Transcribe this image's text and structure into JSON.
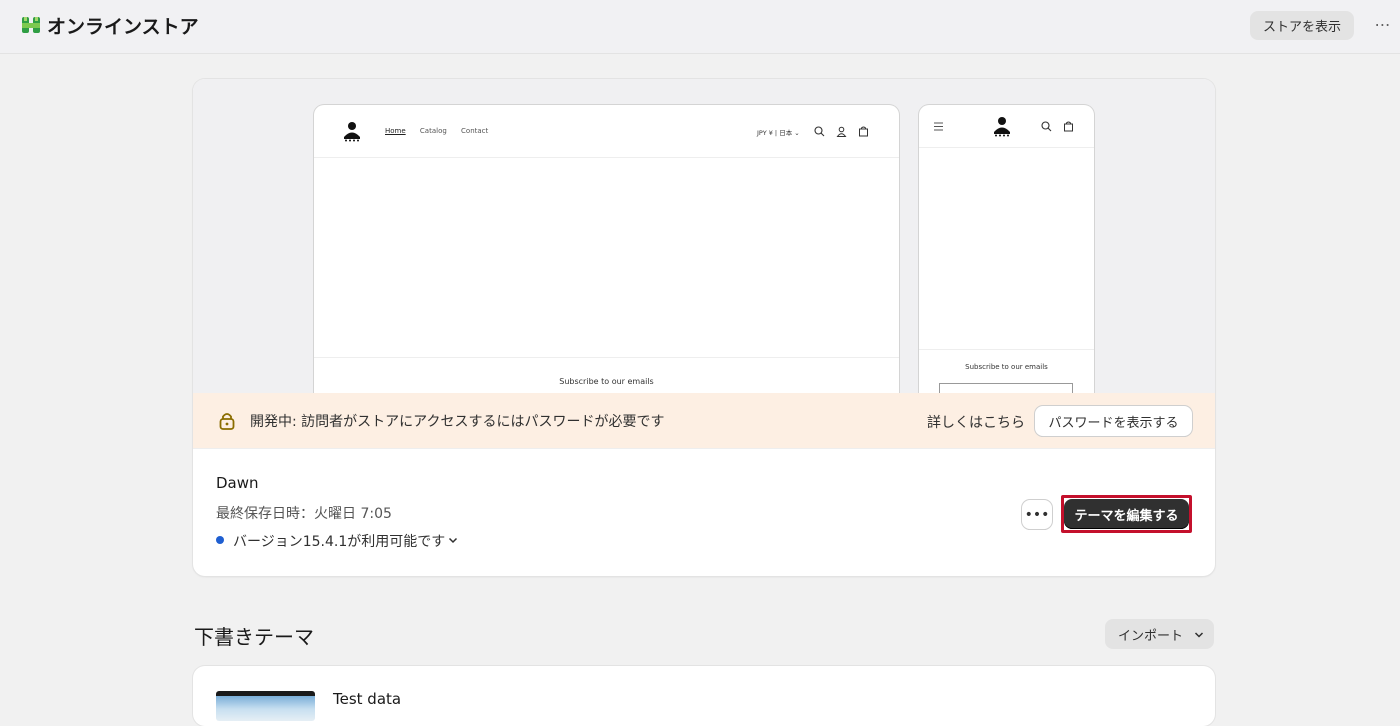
{
  "header": {
    "title": "オンラインストア",
    "view_store_label": "ストアを表示",
    "more_label": "⋯"
  },
  "preview": {
    "desktop_nav": [
      "Home",
      "Catalog",
      "Contact"
    ],
    "locale_label": "JPY ¥ | 日本 ⌄",
    "subscribe_text": "Subscribe to our emails"
  },
  "banner": {
    "text": "開発中: 訪問者がストアにアクセスするにはパスワードが必要です",
    "learn_more": "詳しくはこちら",
    "show_password": "パスワードを表示する"
  },
  "theme": {
    "name": "Dawn",
    "last_saved": "最終保存日時：火曜日 7:05",
    "version_notice": "バージョン15.4.1が利用可能です",
    "more_label": "•••",
    "edit_label": "テーマを編集する"
  },
  "drafts": {
    "section_title": "下書きテーマ",
    "import_label": "インポート",
    "items": [
      {
        "name": "Test data"
      }
    ]
  },
  "colors": {
    "accent": "#1f5fd1",
    "banner_bg": "#fdefe3",
    "primary_button": "#303030",
    "highlight_outline": "#c4102c"
  }
}
